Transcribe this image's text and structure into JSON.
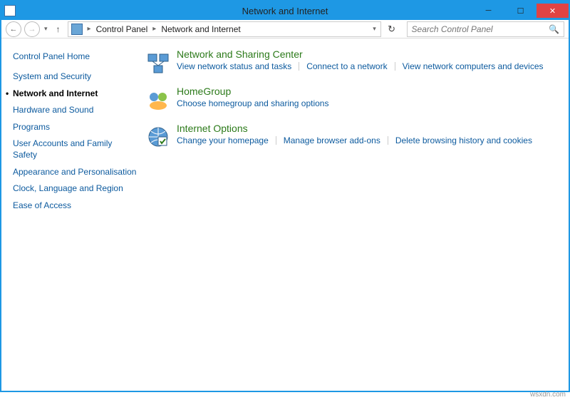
{
  "titlebar": {
    "title": "Network and Internet"
  },
  "breadcrumb": {
    "root": "Control Panel",
    "current": "Network and Internet"
  },
  "search": {
    "placeholder": "Search Control Panel"
  },
  "sidebar": {
    "home": "Control Panel Home",
    "items": [
      "System and Security",
      "Network and Internet",
      "Hardware and Sound",
      "Programs",
      "User Accounts and Family Safety",
      "Appearance and Personalisation",
      "Clock, Language and Region",
      "Ease of Access"
    ],
    "current_index": 1
  },
  "categories": [
    {
      "title": "Network and Sharing Center",
      "links": [
        "View network status and tasks",
        "Connect to a network",
        "View network computers and devices"
      ]
    },
    {
      "title": "HomeGroup",
      "links": [
        "Choose homegroup and sharing options"
      ]
    },
    {
      "title": "Internet Options",
      "links": [
        "Change your homepage",
        "Manage browser add-ons",
        "Delete browsing history and cookies"
      ]
    }
  ],
  "icons": {
    "network_sharing": "network-center-icon",
    "homegroup": "homegroup-icon",
    "internet_options": "internet-options-icon"
  },
  "watermark": "wsxdn.com"
}
